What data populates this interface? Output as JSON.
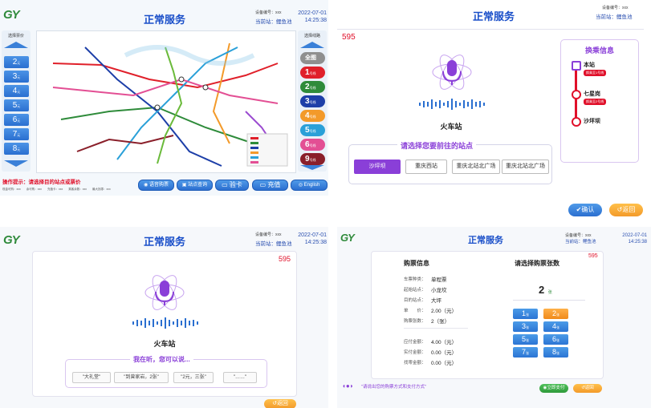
{
  "colors": {
    "accent": "#1a4fc9",
    "purple": "#8a3fd8",
    "green": "#2f8a3b",
    "status_red": "#e0102a",
    "orange": "#f39a2a"
  },
  "common": {
    "logo": "GY",
    "title": "正常服务",
    "device_label": "设备编号：xxx",
    "current_station": "当前站：鲤鱼池",
    "date": "2022-07-01",
    "time": "14:25:38",
    "price_code": "595"
  },
  "p1": {
    "select_fare_label": "选择票价",
    "fares": [
      "2",
      "3",
      "4",
      "5",
      "6",
      "7",
      "8"
    ],
    "fare_unit": "元",
    "select_line_label": "选择线路",
    "line_all": "全图",
    "lines": [
      "1",
      "2",
      "3",
      "4",
      "5",
      "6",
      "9"
    ],
    "line_unit": "号线",
    "tip_label": "操作提示：",
    "tip_text": "请选择目的站点或票价",
    "stats_text": "现金可购：xxx　　余可购：xxx　　充值卡：xxx　　乘客余数：xxx　　最大找零：xxx",
    "buttons": [
      "语音购票",
      "站点查询",
      "验卡",
      "充值",
      "English"
    ]
  },
  "p2": {
    "station_name": "火车站",
    "select_station_label": "请选择您要前往的站点",
    "options": [
      "沙坪坝",
      "重庆西站",
      "重庆北站北广场",
      "重庆北站北广场"
    ],
    "transfer_title": "换乘信息",
    "transfer_stops": [
      {
        "name": "本站",
        "tag": "换乘至1号线"
      },
      {
        "name": "七星岗",
        "tag": "换乘至2号线"
      },
      {
        "name": "沙坪坝",
        "tag": ""
      }
    ],
    "confirm_btn": "确认",
    "back_btn": "返回"
  },
  "p3": {
    "station_name": "火车站",
    "listening_label": "我在听，您可以说...",
    "quotes": [
      "\"大礼堂\"",
      "\"到曾家岩，2张\"",
      "\"2元，三张\"",
      "\"……\""
    ],
    "back_btn": "返回"
  },
  "p4": {
    "info_title": "购票信息",
    "rows": [
      {
        "label": "车票种类：",
        "value": "单程票"
      },
      {
        "label": "起始站点：",
        "value": "小龙坎"
      },
      {
        "label": "目的站点：",
        "value": "大坪"
      },
      {
        "label": "单　　价：",
        "value": "2.00（元）"
      },
      {
        "label": "购票张数：",
        "value": "2（张）"
      }
    ],
    "pay_rows": [
      {
        "label": "应付金额：",
        "value": "4.00（元）"
      },
      {
        "label": "实付金额：",
        "value": "0.00（元）"
      },
      {
        "label": "找零金额：",
        "value": "0.00（元）"
      }
    ],
    "count_title": "请选择购票张数",
    "count_value": "2",
    "count_unit": "张",
    "counts": [
      "1",
      "2",
      "3",
      "4",
      "5",
      "6",
      "7",
      "8"
    ],
    "voice_hint": "\"请说出您的购票方式和支付方式\"",
    "pay_btn": "立即支付",
    "back_btn": "返回"
  }
}
